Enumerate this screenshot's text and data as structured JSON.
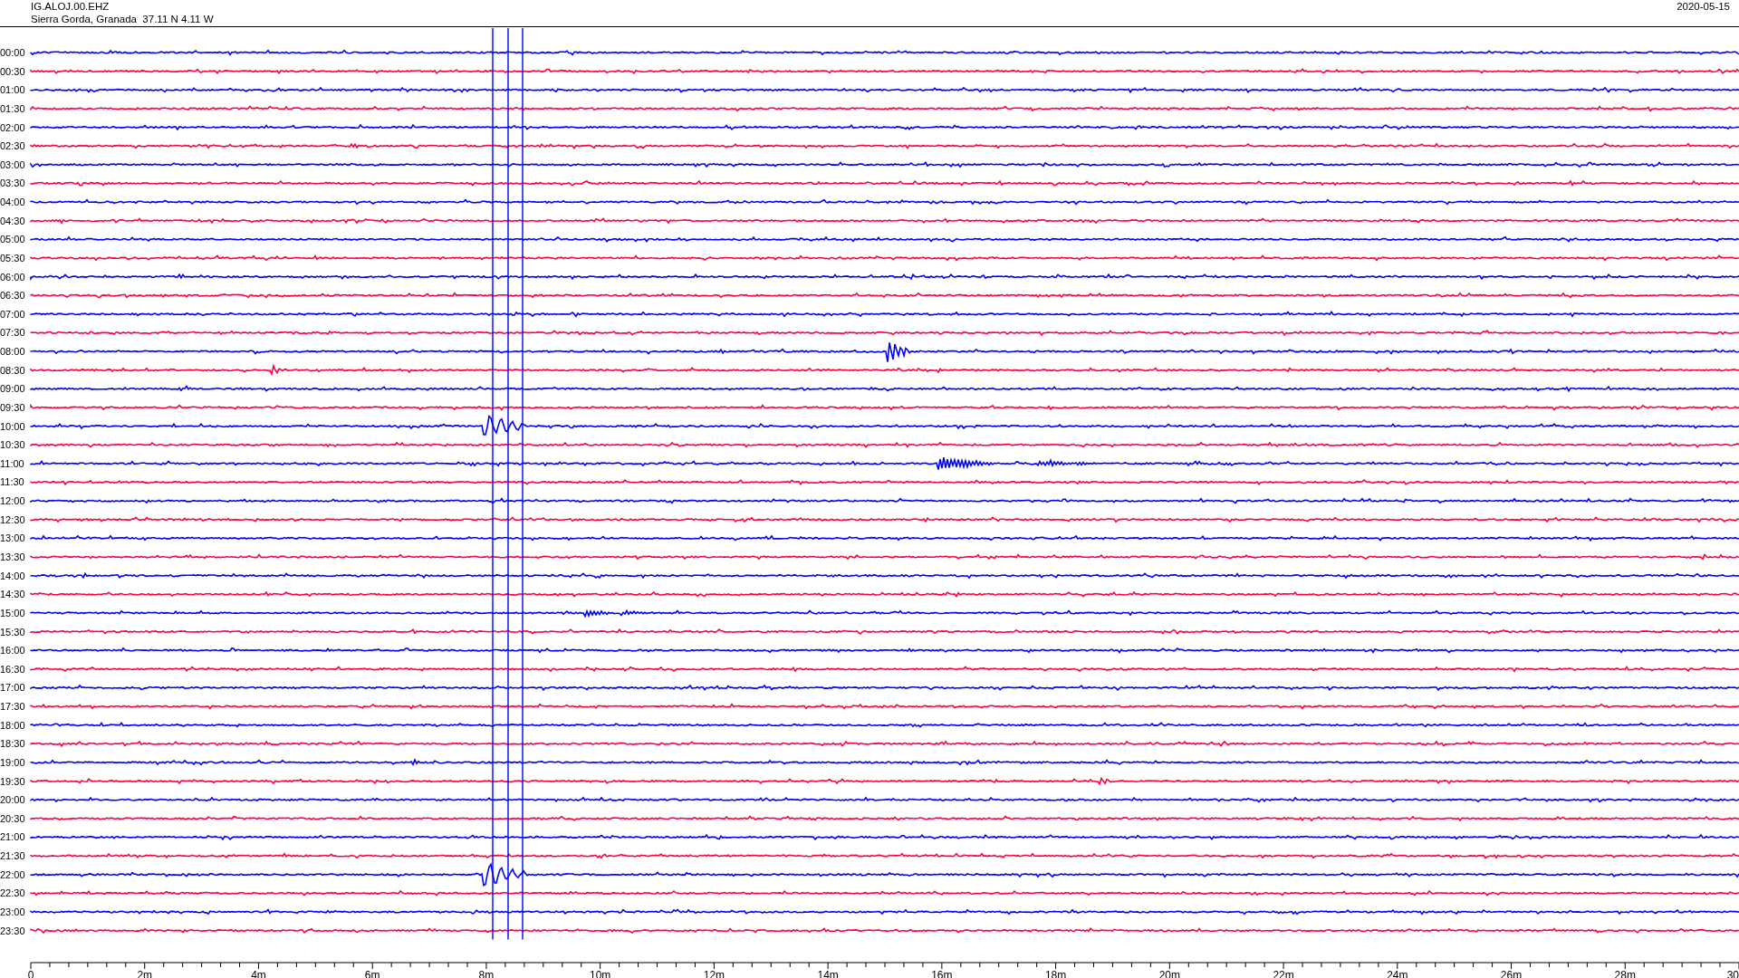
{
  "header": {
    "station": "IG.ALOJ.00.EHZ",
    "location": "Sierra Gorda, Granada  37.11 N 4.11 W",
    "date": "2020-05-15"
  },
  "rows": [
    {
      "label": "00:00",
      "color": "#0000ff"
    },
    {
      "label": "00:30",
      "color": "#ff0040"
    },
    {
      "label": "01:00",
      "color": "#0000ff"
    },
    {
      "label": "01:30",
      "color": "#ff0040"
    },
    {
      "label": "02:00",
      "color": "#0000ff"
    },
    {
      "label": "02:30",
      "color": "#ff0040"
    },
    {
      "label": "03:00",
      "color": "#0000ff"
    },
    {
      "label": "03:30",
      "color": "#ff0040"
    },
    {
      "label": "04:00",
      "color": "#0000ff"
    },
    {
      "label": "04:30",
      "color": "#ff0040"
    },
    {
      "label": "05:00",
      "color": "#0000ff"
    },
    {
      "label": "05:30",
      "color": "#ff0040"
    },
    {
      "label": "06:00",
      "color": "#0000ff"
    },
    {
      "label": "06:30",
      "color": "#ff0040"
    },
    {
      "label": "07:00",
      "color": "#0000ff"
    },
    {
      "label": "07:30",
      "color": "#ff0040"
    },
    {
      "label": "08:00",
      "color": "#0000ff"
    },
    {
      "label": "08:30",
      "color": "#ff0040"
    },
    {
      "label": "09:00",
      "color": "#0000ff"
    },
    {
      "label": "09:30",
      "color": "#ff0040"
    },
    {
      "label": "10:00",
      "color": "#0000ff"
    },
    {
      "label": "10:30",
      "color": "#ff0040"
    },
    {
      "label": "11:00",
      "color": "#0000ff"
    },
    {
      "label": "11:30",
      "color": "#ff0040"
    },
    {
      "label": "12:00",
      "color": "#0000ff"
    },
    {
      "label": "12:30",
      "color": "#ff0040"
    },
    {
      "label": "13:00",
      "color": "#0000ff"
    },
    {
      "label": "13:30",
      "color": "#ff0040"
    },
    {
      "label": "14:00",
      "color": "#0000ff"
    },
    {
      "label": "14:30",
      "color": "#ff0040"
    },
    {
      "label": "15:00",
      "color": "#0000ff"
    },
    {
      "label": "15:30",
      "color": "#ff0040"
    },
    {
      "label": "16:00",
      "color": "#0000ff"
    },
    {
      "label": "16:30",
      "color": "#ff0040"
    },
    {
      "label": "17:00",
      "color": "#0000ff"
    },
    {
      "label": "17:30",
      "color": "#ff0040"
    },
    {
      "label": "18:00",
      "color": "#0000ff"
    },
    {
      "label": "18:30",
      "color": "#ff0040"
    },
    {
      "label": "19:00",
      "color": "#0000ff"
    },
    {
      "label": "19:30",
      "color": "#ff0040"
    },
    {
      "label": "20:00",
      "color": "#0000ff"
    },
    {
      "label": "20:30",
      "color": "#ff0040"
    },
    {
      "label": "21:00",
      "color": "#0000ff"
    },
    {
      "label": "21:30",
      "color": "#ff0040"
    },
    {
      "label": "22:00",
      "color": "#0000ff"
    },
    {
      "label": "22:30",
      "color": "#ff0040"
    },
    {
      "label": "23:00",
      "color": "#0000ff"
    },
    {
      "label": "23:30",
      "color": "#ff0040"
    }
  ],
  "x_axis": {
    "ticks": [
      "0",
      "2m",
      "4m",
      "6m",
      "8m",
      "10m",
      "12m",
      "14m",
      "16m",
      "18m",
      "20m",
      "22m",
      "24m",
      "26m",
      "28m",
      "30"
    ]
  }
}
